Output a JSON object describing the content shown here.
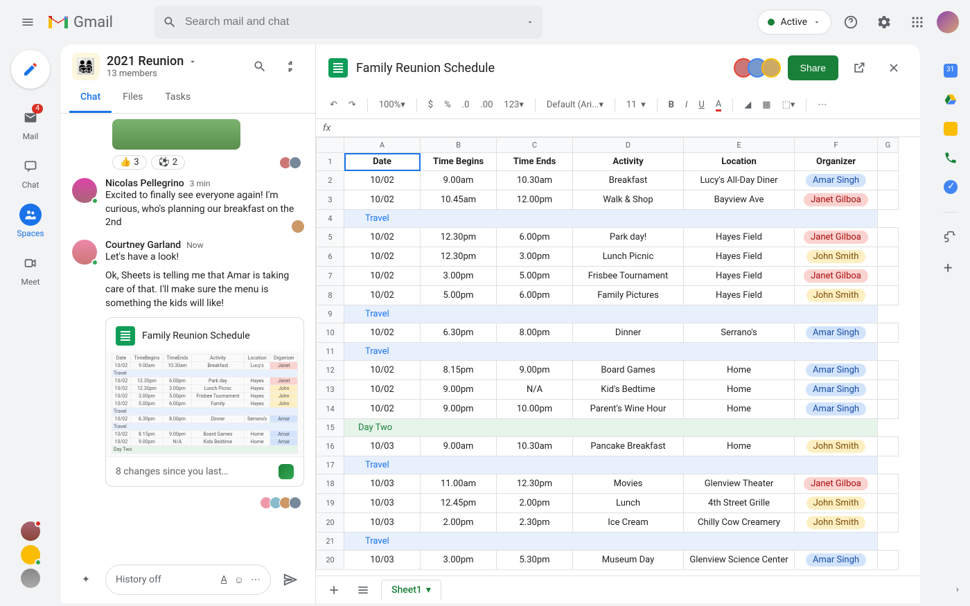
{
  "header": {
    "brand": "Gmail",
    "search_placeholder": "Search mail and chat",
    "status": "Active"
  },
  "rail": {
    "mail": "Mail",
    "mail_badge": "4",
    "chat": "Chat",
    "spaces": "Spaces",
    "meet": "Meet"
  },
  "space": {
    "title": "2021 Reunion",
    "members": "13 members",
    "tabs": {
      "chat": "Chat",
      "files": "Files",
      "tasks": "Tasks"
    }
  },
  "reactions": {
    "thumbs": "3",
    "soccer": "2"
  },
  "messages": [
    {
      "name": "Nicolas Pellegrino",
      "time": "3 min",
      "text": "Excited to finally see everyone again! I'm curious, who's planning our breakfast on the 2nd"
    },
    {
      "name": "Courtney Garland",
      "time": "Now",
      "text1": "Let's have a look!",
      "text2": "Ok, Sheets is telling me that Amar is taking care of that. I'll make sure the menu is something the kids will like!"
    }
  ],
  "sheet_card": {
    "title": "Family Reunion Schedule",
    "foot": "8 changes since you last…"
  },
  "chatbox": {
    "placeholder": "History off"
  },
  "sheet": {
    "title": "Family Reunion Schedule",
    "share": "Share",
    "zoom": "100%",
    "fmt": "123",
    "font": "Default (Ari...",
    "fontsize": "11",
    "tab": "Sheet1"
  },
  "cols": [
    "A",
    "B",
    "C",
    "D",
    "E",
    "F",
    "G"
  ],
  "headers": [
    "Date",
    "Time Begins",
    "Time Ends",
    "Activity",
    "Location",
    "Organizer"
  ],
  "travel": "Travel",
  "daytwo": "Day Two",
  "rows": [
    {
      "n": 2,
      "d": [
        "10/02",
        "9.00am",
        "10.30am",
        "Breakfast",
        "Lucy's All-Day Diner"
      ],
      "o": "Amar Singh",
      "p": "amar"
    },
    {
      "n": 3,
      "d": [
        "10/02",
        "10.45am",
        "12.00pm",
        "Walk & Shop",
        "Bayview Ave"
      ],
      "o": "Janet Gilboa",
      "p": "janet"
    },
    {
      "n": 4,
      "travel": true
    },
    {
      "n": 5,
      "d": [
        "10/02",
        "12.30pm",
        "6.00pm",
        "Park day!",
        "Hayes Field"
      ],
      "o": "Janet Gilboa",
      "p": "janet"
    },
    {
      "n": 6,
      "d": [
        "10/02",
        "12.30pm",
        "3.00pm",
        "Lunch Picnic",
        "Hayes Field"
      ],
      "o": "John Smith",
      "p": "john"
    },
    {
      "n": 7,
      "d": [
        "10/02",
        "3.00pm",
        "5.00pm",
        "Frisbee Tournament",
        "Hayes Field"
      ],
      "o": "Janet Gilboa",
      "p": "janet"
    },
    {
      "n": 8,
      "d": [
        "10/02",
        "5.00pm",
        "6.00pm",
        "Family Pictures",
        "Hayes Field"
      ],
      "o": "John Smith",
      "p": "john"
    },
    {
      "n": 9,
      "travel": true
    },
    {
      "n": 10,
      "d": [
        "10/02",
        "6.30pm",
        "8.00pm",
        "Dinner",
        "Serrano's"
      ],
      "o": "Amar Singh",
      "p": "amar"
    },
    {
      "n": 11,
      "travel": true
    },
    {
      "n": 12,
      "d": [
        "10/02",
        "8.15pm",
        "9.00pm",
        "Board Games",
        "Home"
      ],
      "o": "Amar Singh",
      "p": "amar"
    },
    {
      "n": 13,
      "d": [
        "10/02",
        "9.00pm",
        "N/A",
        "Kid's Bedtime",
        "Home"
      ],
      "o": "Amar Singh",
      "p": "amar"
    },
    {
      "n": 14,
      "d": [
        "10/02",
        "9.00pm",
        "10.00pm",
        "Parent's Wine Hour",
        "Home"
      ],
      "o": "Amar Singh",
      "p": "amar"
    },
    {
      "n": 15,
      "daytwo": true
    },
    {
      "n": 16,
      "d": [
        "10/03",
        "9.00am",
        "10.30am",
        "Pancake Breakfast",
        "Home"
      ],
      "o": "John Smith",
      "p": "john"
    },
    {
      "n": 17,
      "travel": true
    },
    {
      "n": 18,
      "d": [
        "10/03",
        "11.00am",
        "12.30pm",
        "Movies",
        "Glenview Theater"
      ],
      "o": "Janet Gilboa",
      "p": "janet"
    },
    {
      "n": 19,
      "d": [
        "10/03",
        "12.45pm",
        "2.00pm",
        "Lunch",
        "4th Street Grille"
      ],
      "o": "John Smith",
      "p": "john"
    },
    {
      "n": 20,
      "d": [
        "10/03",
        "2.00pm",
        "2.30pm",
        "Ice Cream",
        "Chilly Cow Creamery"
      ],
      "o": "John Smith",
      "p": "john"
    },
    {
      "n": 21,
      "travel": true
    },
    {
      "n": 20,
      "d": [
        "10/03",
        "3.00pm",
        "5.30pm",
        "Museum Day",
        "Glenview Science Center"
      ],
      "o": "Amar Singh",
      "p": "amar"
    }
  ]
}
